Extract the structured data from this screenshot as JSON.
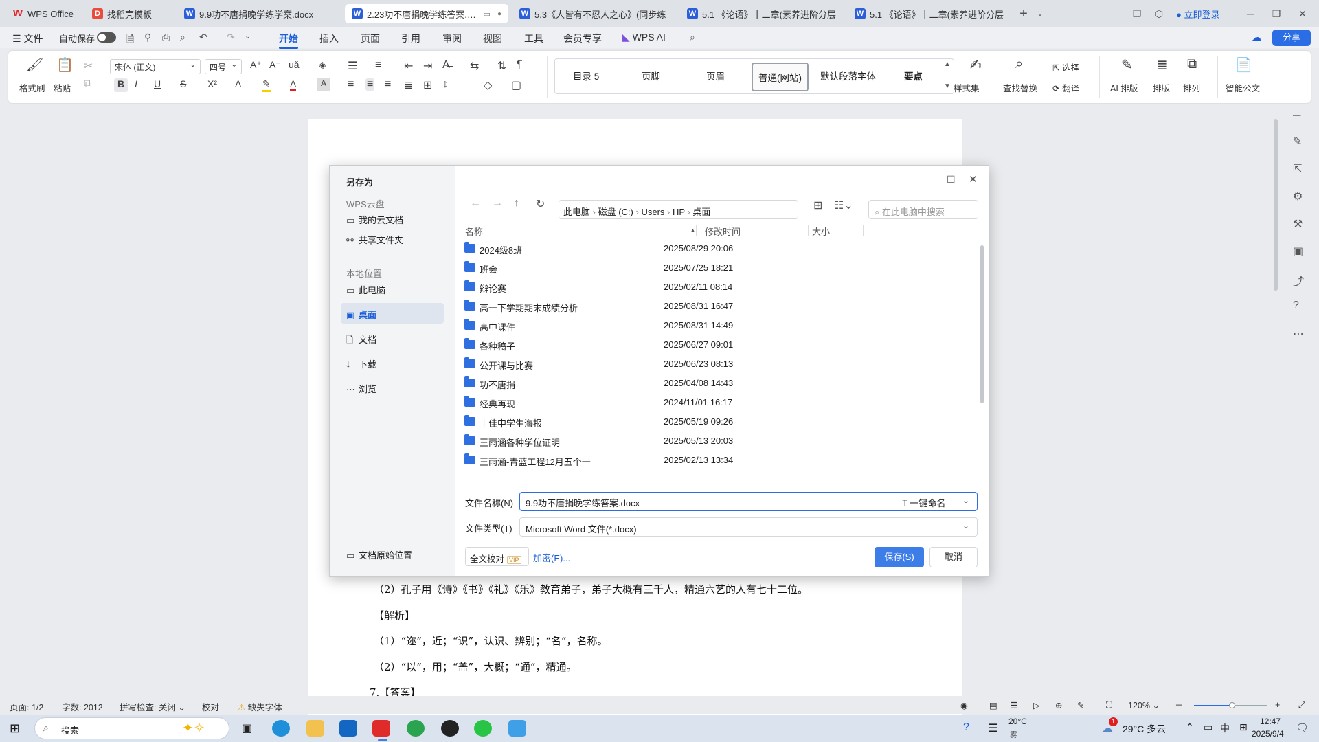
{
  "tabs": [
    {
      "label": "WPS Office",
      "icon": "wps-logo-icon"
    },
    {
      "label": "找稻壳模板",
      "icon": "daoke-icon"
    },
    {
      "label": "9.9功不唐捐晚学练学案.docx",
      "icon": "word-doc-icon"
    },
    {
      "label": "2.23功不唐捐晚学练答案.docx",
      "icon": "word-doc-icon"
    },
    {
      "label": "5.3《人皆有不忍人之心》(同步练",
      "icon": "word-doc-icon"
    },
    {
      "label": "5.1 《论语》十二章(素养进阶分层",
      "icon": "word-doc-icon"
    },
    {
      "label": "5.1 《论语》十二章(素养进阶分层",
      "icon": "word-doc-icon"
    }
  ],
  "header": {
    "login": "立即登录",
    "share": "分享"
  },
  "menu": {
    "file": "文件",
    "autosave": "自动保存",
    "items": [
      "开始",
      "插入",
      "页面",
      "引用",
      "审阅",
      "视图",
      "工具",
      "会员专享",
      "WPS AI"
    ],
    "active": "开始"
  },
  "ribbon": {
    "format_painter": "格式刷",
    "paste": "粘贴",
    "font": "宋体 (正文)",
    "size": "四号",
    "styles": [
      "目录 5",
      "页脚",
      "页眉",
      "普通(网站)",
      "默认段落字体",
      "要点"
    ],
    "style_set": "样式集",
    "find_replace": "查找替换",
    "select": "选择",
    "translate": "翻译",
    "ai_layout": "AI 排版",
    "layout": "排版",
    "arrange": "排列",
    "smart_doc": "智能公文"
  },
  "doc_lines": [
    "（2）孔子用《诗》《书》《礼》《乐》教育弟子，弟子大概有三千人，精通六艺的人有七十二位。",
    "【解析】",
    "（1）“迩”，近；“识”，认识、辨别；“名”，名称。",
    "（2）“以”，用；“盖”，大概；“通”，精通。",
    "7.【答案】"
  ],
  "dialog": {
    "title": "另存为",
    "cloud_section": "WPS云盘",
    "cloud_items": [
      "我的云文档",
      "共享文件夹"
    ],
    "local_section": "本地位置",
    "local_items": [
      "此电脑",
      "桌面",
      "文档",
      "下载",
      "浏览"
    ],
    "selected_location": "桌面",
    "original_location": "文档原始位置",
    "breadcrumb": [
      "此电脑",
      "磁盘 (C:)",
      "Users",
      "HP",
      "桌面"
    ],
    "search_placeholder": "在此电脑中搜索",
    "columns": {
      "name": "名称",
      "modified": "修改时间",
      "size": "大小"
    },
    "files": [
      {
        "name": "2024级8班",
        "modified": "2025/08/29 20:06"
      },
      {
        "name": "班会",
        "modified": "2025/07/25 18:21"
      },
      {
        "name": "辩论赛",
        "modified": "2025/02/11 08:14"
      },
      {
        "name": "高一下学期期末成绩分析",
        "modified": "2025/08/31 16:47"
      },
      {
        "name": "高中课件",
        "modified": "2025/08/31 14:49"
      },
      {
        "name": "各种稿子",
        "modified": "2025/06/27 09:01"
      },
      {
        "name": "公开课与比赛",
        "modified": "2025/06/23 08:13"
      },
      {
        "name": "功不唐捐",
        "modified": "2025/04/08 14:43"
      },
      {
        "name": "经典再现",
        "modified": "2024/11/01 16:17"
      },
      {
        "name": "十佳中学生海报",
        "modified": "2025/05/19 09:26"
      },
      {
        "name": "王雨涵各种学位证明",
        "modified": "2025/05/13 20:03"
      },
      {
        "name": "王雨涵-青蓝工程12月五个一",
        "modified": "2025/02/13 13:34"
      }
    ],
    "filename_label": "文件名称(N)",
    "filename_value": "9.9功不唐捐晚学练答案.docx",
    "rename_label": "一键命名",
    "filetype_label": "文件类型(T)",
    "filetype_value": "Microsoft Word 文件(*.docx)",
    "proofread": "全文校对",
    "vip": "VIP",
    "encrypt": "加密(E)...",
    "save": "保存(S)",
    "cancel": "取消"
  },
  "status": {
    "page": "页面: 1/2",
    "words": "字数: 2012",
    "spellcheck": "拼写检查: 关闭",
    "proof": "校对",
    "missing_font": "缺失字体",
    "zoom": "120%"
  },
  "taskbar": {
    "search": "搜索",
    "temp1": "20°C",
    "temp1_sub": "雾",
    "weather": "29°C 多云",
    "ime": "中",
    "time": "12:47",
    "date": "2025/9/4",
    "badge": "1"
  }
}
